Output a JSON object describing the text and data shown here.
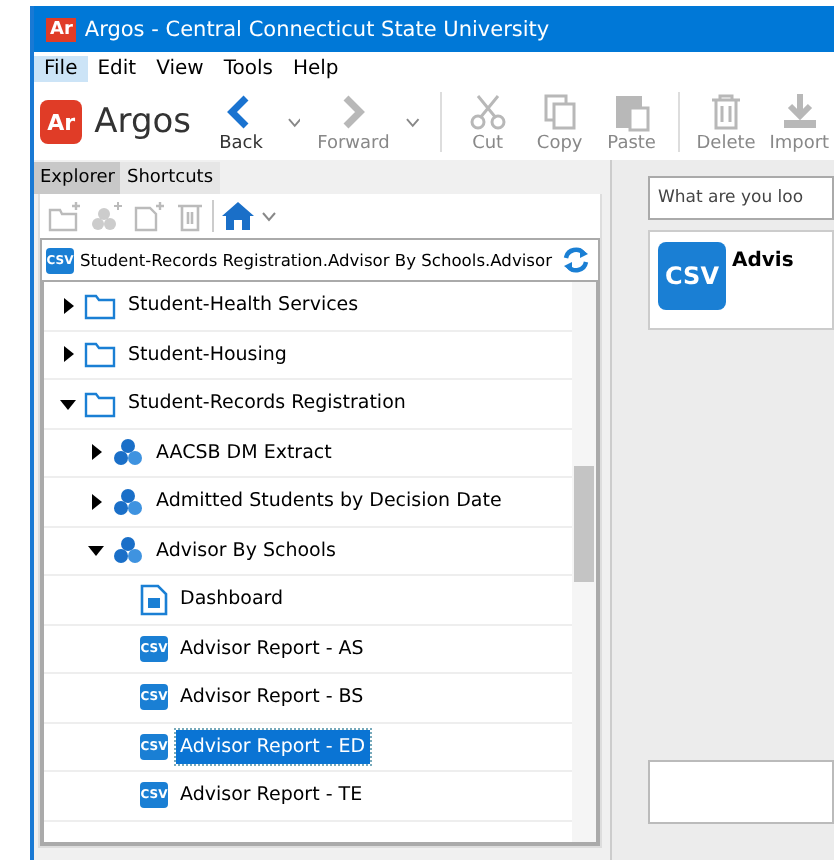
{
  "window": {
    "title": "Argos - Central Connecticut State University",
    "app_badge": "Ar"
  },
  "menu": [
    {
      "label": "File",
      "selected": true
    },
    {
      "label": "Edit",
      "selected": false
    },
    {
      "label": "View",
      "selected": false
    },
    {
      "label": "Tools",
      "selected": false
    },
    {
      "label": "Help",
      "selected": false
    }
  ],
  "toolbar": {
    "logo_badge": "Ar",
    "logo_text": "Argos",
    "buttons": [
      {
        "kind": "back",
        "label": "Back",
        "disabled": false,
        "dropdown": true
      },
      {
        "kind": "forward",
        "label": "Forward",
        "disabled": true,
        "dropdown": true
      },
      {
        "kind": "cut",
        "label": "Cut",
        "disabled": true
      },
      {
        "kind": "copy",
        "label": "Copy",
        "disabled": true
      },
      {
        "kind": "paste",
        "label": "Paste",
        "disabled": true
      },
      {
        "kind": "delete",
        "label": "Delete",
        "disabled": true
      },
      {
        "kind": "import",
        "label": "Import",
        "disabled": true
      }
    ]
  },
  "panel_tabs": [
    {
      "label": "Explorer",
      "selected": true
    },
    {
      "label": "Shortcuts",
      "selected": false
    }
  ],
  "path_bar": {
    "badge": "CSV",
    "path": "Student-Records Registration.Advisor By Schools.Advisor"
  },
  "tree": [
    {
      "kind": "folder",
      "label": "Student-Health Services",
      "expanded": false,
      "selected": false
    },
    {
      "kind": "folder",
      "label": "Student-Housing",
      "expanded": false,
      "selected": false
    },
    {
      "kind": "folder",
      "label": "Student-Records Registration",
      "expanded": true,
      "selected": false,
      "children": [
        {
          "kind": "dataset",
          "label": "AACSB DM Extract",
          "expanded": false,
          "selected": false
        },
        {
          "kind": "dataset",
          "label": "Admitted Students by Decision Date",
          "expanded": false,
          "selected": false
        },
        {
          "kind": "dataset",
          "label": "Advisor By Schools",
          "expanded": true,
          "selected": false,
          "children": [
            {
              "kind": "dashboard",
              "label": "Dashboard",
              "selected": false
            },
            {
              "kind": "csv",
              "label": "Advisor Report - AS",
              "badge": "CSV",
              "selected": false
            },
            {
              "kind": "csv",
              "label": "Advisor Report - BS",
              "badge": "CSV",
              "selected": false
            },
            {
              "kind": "csv",
              "label": "Advisor Report - ED",
              "badge": "CSV",
              "selected": true
            },
            {
              "kind": "csv",
              "label": "Advisor Report - TE",
              "badge": "CSV",
              "selected": false
            }
          ]
        }
      ]
    }
  ],
  "search": {
    "placeholder": "What are you loo"
  },
  "detail_card": {
    "badge": "CSV",
    "title": "Advis"
  }
}
